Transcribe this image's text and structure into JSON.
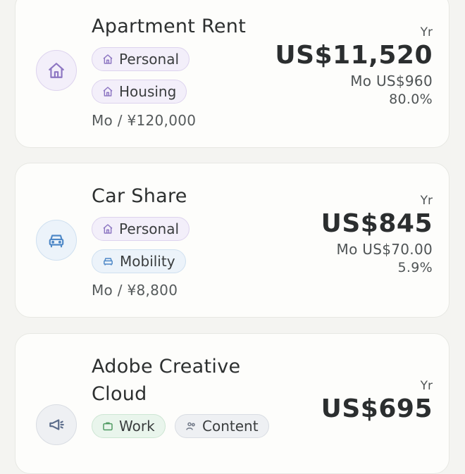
{
  "expenses": [
    {
      "title": "Apartment Rent",
      "tags": [
        {
          "label": "Personal",
          "icon": "home-icon",
          "color": "#8d76c2"
        },
        {
          "label": "Housing",
          "icon": "home-icon",
          "color": "#8d76c2"
        }
      ],
      "monthly_local": "Mo / ¥120,000",
      "yr_label": "Yr",
      "annual": "US$11,520",
      "monthly": "Mo US$960",
      "percent": "80.0%",
      "icon": "home-icon",
      "icon_color": "#8d76c2"
    },
    {
      "title": "Car Share",
      "tags": [
        {
          "label": "Personal",
          "icon": "home-icon",
          "color": "#8d76c2"
        },
        {
          "label": "Mobility",
          "icon": "car-icon",
          "color": "#4e88c7"
        }
      ],
      "monthly_local": "Mo / ¥8,800",
      "yr_label": "Yr",
      "annual": "US$845",
      "monthly": "Mo US$70.00",
      "percent": "5.9%",
      "icon": "car-icon",
      "icon_color": "#4e88c7"
    },
    {
      "title": "Adobe Creative Cloud",
      "tags": [
        {
          "label": "Work",
          "icon": "briefcase-icon",
          "color": "#4f9a62"
        },
        {
          "label": "Content",
          "icon": "people-icon",
          "color": "#6f7786"
        }
      ],
      "yr_label": "Yr",
      "annual": "US$695",
      "icon": "megaphone-icon",
      "icon_color": "#5a6b8a"
    }
  ]
}
